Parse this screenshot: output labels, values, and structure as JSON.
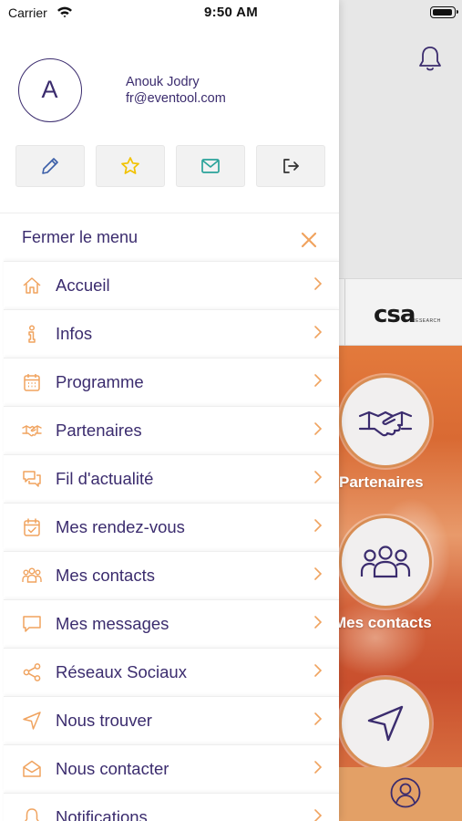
{
  "status_bar": {
    "carrier": "Carrier",
    "time": "9:50 AM"
  },
  "colors": {
    "accent": "#f0a35f",
    "primary_text": "#3b2c6e",
    "background": "#ffffff"
  },
  "user": {
    "avatar_initial": "A",
    "name": "Anouk Jodry",
    "email": "fr@eventool.com"
  },
  "actions": [
    {
      "icon": "pencil-icon",
      "color": "#3b5fa8"
    },
    {
      "icon": "star-icon",
      "color": "#f2c200"
    },
    {
      "icon": "envelope-icon",
      "color": "#2aa39a"
    },
    {
      "icon": "logout-icon",
      "color": "#333333"
    }
  ],
  "close_menu": {
    "label": "Fermer le menu"
  },
  "menu": {
    "items": [
      {
        "label": "Accueil",
        "icon": "home-icon"
      },
      {
        "label": "Infos",
        "icon": "info-icon"
      },
      {
        "label": "Programme",
        "icon": "calendar-icon"
      },
      {
        "label": "Partenaires",
        "icon": "handshake-icon"
      },
      {
        "label": "Fil d'actualité",
        "icon": "chat-bubbles-icon"
      },
      {
        "label": "Mes rendez-vous",
        "icon": "calendar-check-icon"
      },
      {
        "label": "Mes contacts",
        "icon": "people-icon"
      },
      {
        "label": "Mes messages",
        "icon": "message-icon"
      },
      {
        "label": "Réseaux Sociaux",
        "icon": "share-icon"
      },
      {
        "label": "Nous trouver",
        "icon": "location-arrow-icon"
      },
      {
        "label": "Nous contacter",
        "icon": "open-envelope-icon"
      },
      {
        "label": "Notifications",
        "icon": "bell-icon"
      }
    ]
  },
  "background_app": {
    "sponsor_logo": "csa",
    "sponsor_logo_sub": "RESEARCH",
    "tiles": [
      {
        "label": "Partenaires",
        "icon": "handshake-icon"
      },
      {
        "label": "Mes contacts",
        "icon": "people-icon"
      },
      {
        "label": "",
        "icon": "location-arrow-icon"
      }
    ]
  }
}
